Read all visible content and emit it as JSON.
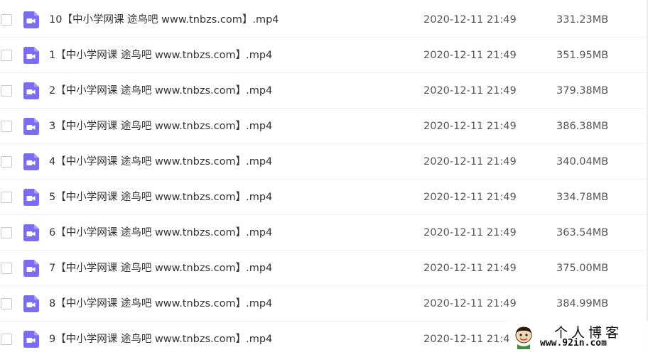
{
  "colors": {
    "video_icon": "#7b6cf6",
    "divider": "#f2f2f2"
  },
  "files": [
    {
      "name": "10【中小学网课 途鸟吧 www.tnbzs.com】.mp4",
      "date": "2020-12-11 21:49",
      "size": "331.23MB",
      "icon": "video-file-icon"
    },
    {
      "name": "1【中小学网课 途鸟吧 www.tnbzs.com】.mp4",
      "date": "2020-12-11 21:49",
      "size": "351.95MB",
      "icon": "video-file-icon"
    },
    {
      "name": "2【中小学网课 途鸟吧 www.tnbzs.com】.mp4",
      "date": "2020-12-11 21:49",
      "size": "379.38MB",
      "icon": "video-file-icon"
    },
    {
      "name": "3【中小学网课 途鸟吧 www.tnbzs.com】.mp4",
      "date": "2020-12-11 21:49",
      "size": "386.38MB",
      "icon": "video-file-icon"
    },
    {
      "name": "4【中小学网课 途鸟吧 www.tnbzs.com】.mp4",
      "date": "2020-12-11 21:49",
      "size": "340.04MB",
      "icon": "video-file-icon"
    },
    {
      "name": "5【中小学网课 途鸟吧 www.tnbzs.com】.mp4",
      "date": "2020-12-11 21:49",
      "size": "334.78MB",
      "icon": "video-file-icon"
    },
    {
      "name": "6【中小学网课 途鸟吧 www.tnbzs.com】.mp4",
      "date": "2020-12-11 21:49",
      "size": "363.54MB",
      "icon": "video-file-icon"
    },
    {
      "name": "7【中小学网课 途鸟吧 www.tnbzs.com】.mp4",
      "date": "2020-12-11 21:49",
      "size": "375.00MB",
      "icon": "video-file-icon"
    },
    {
      "name": "8【中小学网课 途鸟吧 www.tnbzs.com】.mp4",
      "date": "2020-12-11 21:49",
      "size": "384.99MB",
      "icon": "video-file-icon"
    },
    {
      "name": "9【中小学网课 途鸟吧 www.tnbzs.com】.mp4",
      "date": "2020-12-11 21:4",
      "size": "",
      "icon": "video-file-icon"
    }
  ],
  "watermark": {
    "title": "个人博客",
    "url": "www.92in.com"
  }
}
